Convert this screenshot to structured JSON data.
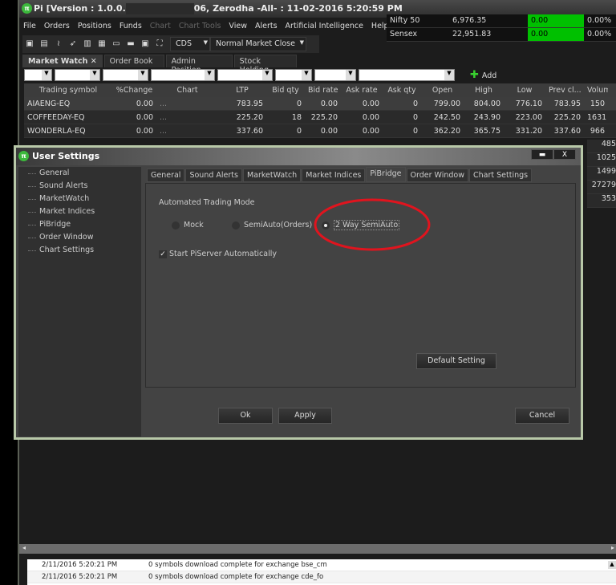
{
  "app": {
    "title_prefix": "Pi [Version : 1.0.0.",
    "title_suffix": "06, Zerodha -All- : 11-02-2016 5:20:59 PM",
    "menu": [
      "File",
      "Orders",
      "Positions",
      "Funds",
      "Chart",
      "Chart Tools",
      "View",
      "Alerts",
      "Artificial Intelligence",
      "Help"
    ],
    "disabled_menu": [
      "Chart",
      "Chart Tools"
    ],
    "toolbar": {
      "exchange": "CDS",
      "market_status": "Normal Market Close"
    },
    "indices": [
      {
        "name": "Nifty 50",
        "value": "6,976.35",
        "change": "0.00",
        "pct": "0.00%"
      },
      {
        "name": "Sensex",
        "value": "22,951.83",
        "change": "0.00",
        "pct": "0.00%"
      }
    ],
    "tabs": [
      "Market Watch",
      "Order Book",
      "Admin Position",
      "Stock Holding"
    ],
    "active_tab": "Market Watch",
    "add_label": "Add",
    "grid": {
      "columns": [
        "Trading symbol",
        "%Change",
        "Chart",
        "LTP",
        "Bid qty",
        "Bid rate",
        "Ask rate",
        "Ask qty",
        "Open",
        "High",
        "Low",
        "Prev cl...",
        "Volum"
      ],
      "rows": [
        [
          "AIAENG-EQ",
          "0.00",
          "...",
          "783.95",
          "0",
          "0.00",
          "0.00",
          "0",
          "799.00",
          "804.00",
          "776.10",
          "783.95",
          "150"
        ],
        [
          "COFFEEDAY-EQ",
          "0.00",
          "...",
          "225.20",
          "18",
          "225.20",
          "0.00",
          "0",
          "242.50",
          "243.90",
          "223.00",
          "225.20",
          "1631"
        ],
        [
          "WONDERLA-EQ",
          "0.00",
          "...",
          "337.60",
          "0",
          "0.00",
          "0.00",
          "0",
          "362.20",
          "365.75",
          "331.20",
          "337.60",
          "966"
        ]
      ],
      "more_volumes": [
        "485",
        "1025",
        "1499",
        "27279",
        "353"
      ]
    },
    "log": [
      {
        "time": "2/11/2016 5:20:21 PM",
        "msg": "0 symbols download complete for exchange bse_cm"
      },
      {
        "time": "2/11/2016 5:20:21 PM",
        "msg": "0 symbols download complete for exchange cde_fo"
      }
    ]
  },
  "dialog": {
    "title": "User Settings",
    "minimize": "▬",
    "close": "X",
    "tree": [
      "General",
      "Sound Alerts",
      "MarketWatch",
      "Market Indices",
      "PiBridge",
      "Order Window",
      "Chart Settings"
    ],
    "tabs": [
      "General",
      "Sound Alerts",
      "MarketWatch",
      "Market Indices",
      "PiBridge",
      "Order Window",
      "Chart Settings"
    ],
    "active_tab": "PiBridge",
    "section_label": "Automated Trading Mode",
    "modes": [
      {
        "label": "Mock",
        "selected": false
      },
      {
        "label": "SemiAuto(Orders)",
        "selected": false
      },
      {
        "label": "2 Way SemiAuto",
        "selected": true
      }
    ],
    "start_piserver": {
      "label": "Start PiServer Automatically",
      "checked": true
    },
    "default_button": "Default Setting",
    "ok": "Ok",
    "apply": "Apply",
    "cancel": "Cancel",
    "highlight_color": "#e0141e"
  }
}
